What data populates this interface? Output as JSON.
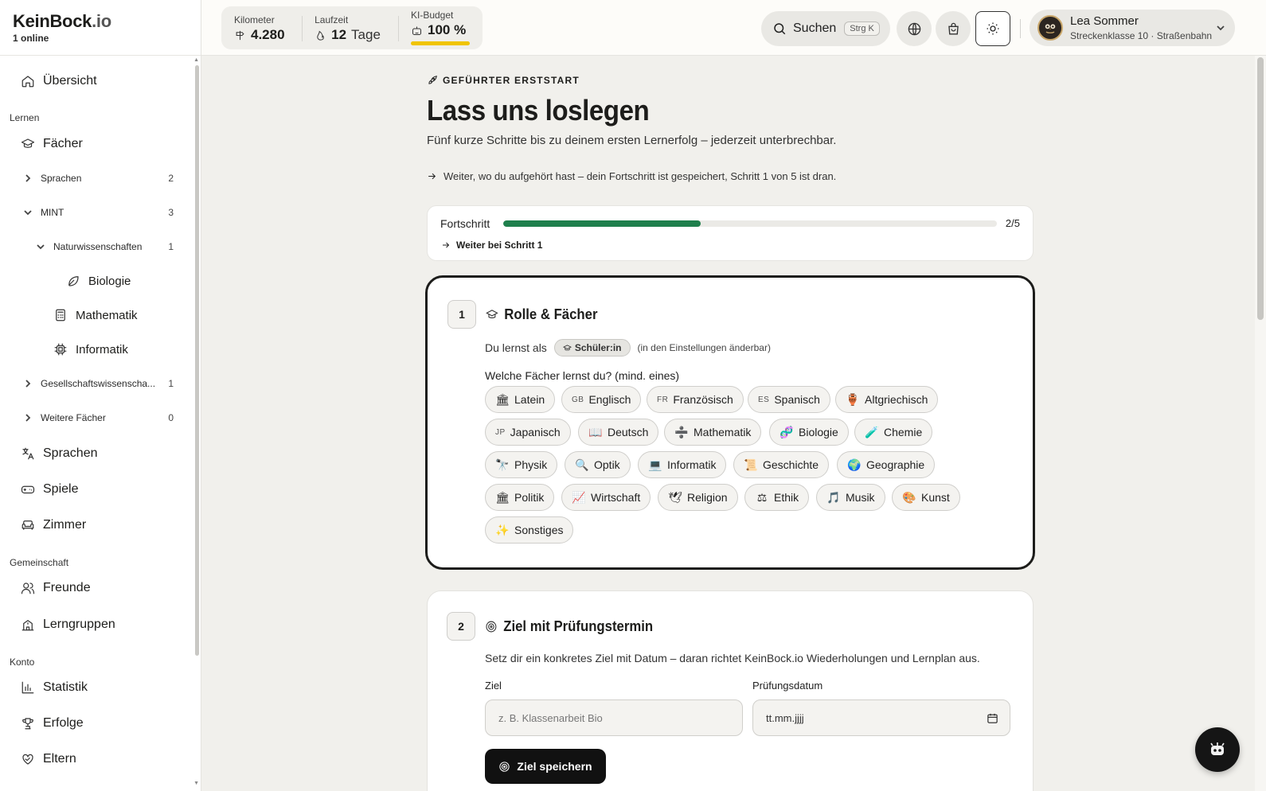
{
  "brand": {
    "name_main": "KeinBock",
    "name_tld": ".io",
    "online": "1 online"
  },
  "sidebar": {
    "overview": "Übersicht",
    "section_learn": "Lernen",
    "faecher": "Fächer",
    "tree": {
      "sprachen": {
        "label": "Sprachen",
        "count": "2"
      },
      "mint": {
        "label": "MINT",
        "count": "3"
      },
      "naturwissenschaften": {
        "label": "Naturwissenschaften",
        "count": "1"
      },
      "biologie": "Biologie",
      "mathematik": "Mathematik",
      "informatik": "Informatik",
      "gesellschaft": {
        "label": "Gesellschaftswissenscha...",
        "count": "1"
      },
      "weitere": {
        "label": "Weitere Fächer",
        "count": "0"
      }
    },
    "sprachen": "Sprachen",
    "spiele": "Spiele",
    "zimmer": "Zimmer",
    "section_community": "Gemeinschaft",
    "freunde": "Freunde",
    "lerngruppen": "Lerngruppen",
    "section_account": "Konto",
    "statistik": "Statistik",
    "erfolge": "Erfolge",
    "eltern": "Eltern"
  },
  "topbar": {
    "km_label": "Kilometer",
    "km_value": "4.280",
    "time_label": "Laufzeit",
    "time_value": "12",
    "time_unit": "Tage",
    "budget_label": "KI-Budget",
    "budget_value": "100 %",
    "budget_fraction": 1.0,
    "search_label": "Suchen",
    "search_kbd": "Strg K",
    "user_name": "Lea Sommer",
    "user_sub": "Streckenklasse 10 · Straßenbahn"
  },
  "onboarding": {
    "kicker": "GEFÜHRTER ERSTSTART",
    "title": "Lass uns loslegen",
    "subtitle": "Fünf kurze Schritte bis zu deinem ersten Lernerfolg – jederzeit unterbrechbar.",
    "resume": "Weiter, wo du aufgehört hast – dein Fortschritt ist gespeichert, Schritt 1 von 5 ist dran.",
    "progress_label": "Fortschritt",
    "progress_count": "2/5",
    "progress_value": 0.4,
    "progress_link": "Weiter bei Schritt 1"
  },
  "step1": {
    "number": "1",
    "title": "Rolle & Fächer",
    "role_prefix": "Du lernst als",
    "role_chip": "Schüler:in",
    "role_hint": "(in den Einstellungen änderbar)",
    "question": "Welche Fächer lernst du? (mind. eines)",
    "subjects": [
      {
        "label": "Latein",
        "icon": "🏛"
      },
      {
        "label": "Englisch",
        "code": "GB"
      },
      {
        "label": "Französisch",
        "code": "FR"
      },
      {
        "label": "Spanisch",
        "code": "ES"
      },
      {
        "label": "Altgriechisch",
        "icon": "🏺"
      },
      {
        "label": "Japanisch",
        "code": "JP"
      },
      {
        "label": "Deutsch",
        "icon": "📖"
      },
      {
        "label": "Mathematik",
        "icon": "➗"
      },
      {
        "label": "Biologie",
        "icon": "🧬"
      },
      {
        "label": "Chemie",
        "icon": "🧪"
      },
      {
        "label": "Physik",
        "icon": "🔭"
      },
      {
        "label": "Optik",
        "icon": "🔍"
      },
      {
        "label": "Informatik",
        "icon": "💻"
      },
      {
        "label": "Geschichte",
        "icon": "📜"
      },
      {
        "label": "Geographie",
        "icon": "🌍"
      },
      {
        "label": "Politik",
        "icon": "🏛"
      },
      {
        "label": "Wirtschaft",
        "icon": "📈"
      },
      {
        "label": "Religion",
        "icon": "🕊"
      },
      {
        "label": "Ethik",
        "icon": "⚖"
      },
      {
        "label": "Musik",
        "icon": "🎵"
      },
      {
        "label": "Kunst",
        "icon": "🎨"
      },
      {
        "label": "Sonstiges",
        "icon": "✨"
      }
    ]
  },
  "step2": {
    "number": "2",
    "title": "Ziel mit Prüfungstermin",
    "desc": "Setz dir ein konkretes Ziel mit Datum – daran richtet KeinBock.io Wiederholungen und Lernplan aus.",
    "goal_label": "Ziel",
    "goal_placeholder": "z. B. Klassenarbeit Bio",
    "date_label": "Prüfungsdatum",
    "date_placeholder": "tt.mm.jjjj",
    "save_label": "Ziel speichern"
  }
}
